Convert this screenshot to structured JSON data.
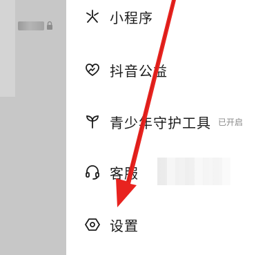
{
  "menu": {
    "items": [
      {
        "label": "小程序",
        "icon": "mini-program-icon"
      },
      {
        "label": "抖音公益",
        "icon": "charity-heart-icon"
      },
      {
        "label": "青少年守护工具",
        "icon": "sprout-icon",
        "badge": "已开启"
      },
      {
        "label": "客服",
        "icon": "headset-icon"
      },
      {
        "label": "设置",
        "icon": "settings-hexagon-icon"
      }
    ]
  },
  "colors": {
    "arrow": "#e8231f",
    "panel": "#c7c7c7",
    "text": "#1b1b1b",
    "badge": "#8a8a8a"
  }
}
